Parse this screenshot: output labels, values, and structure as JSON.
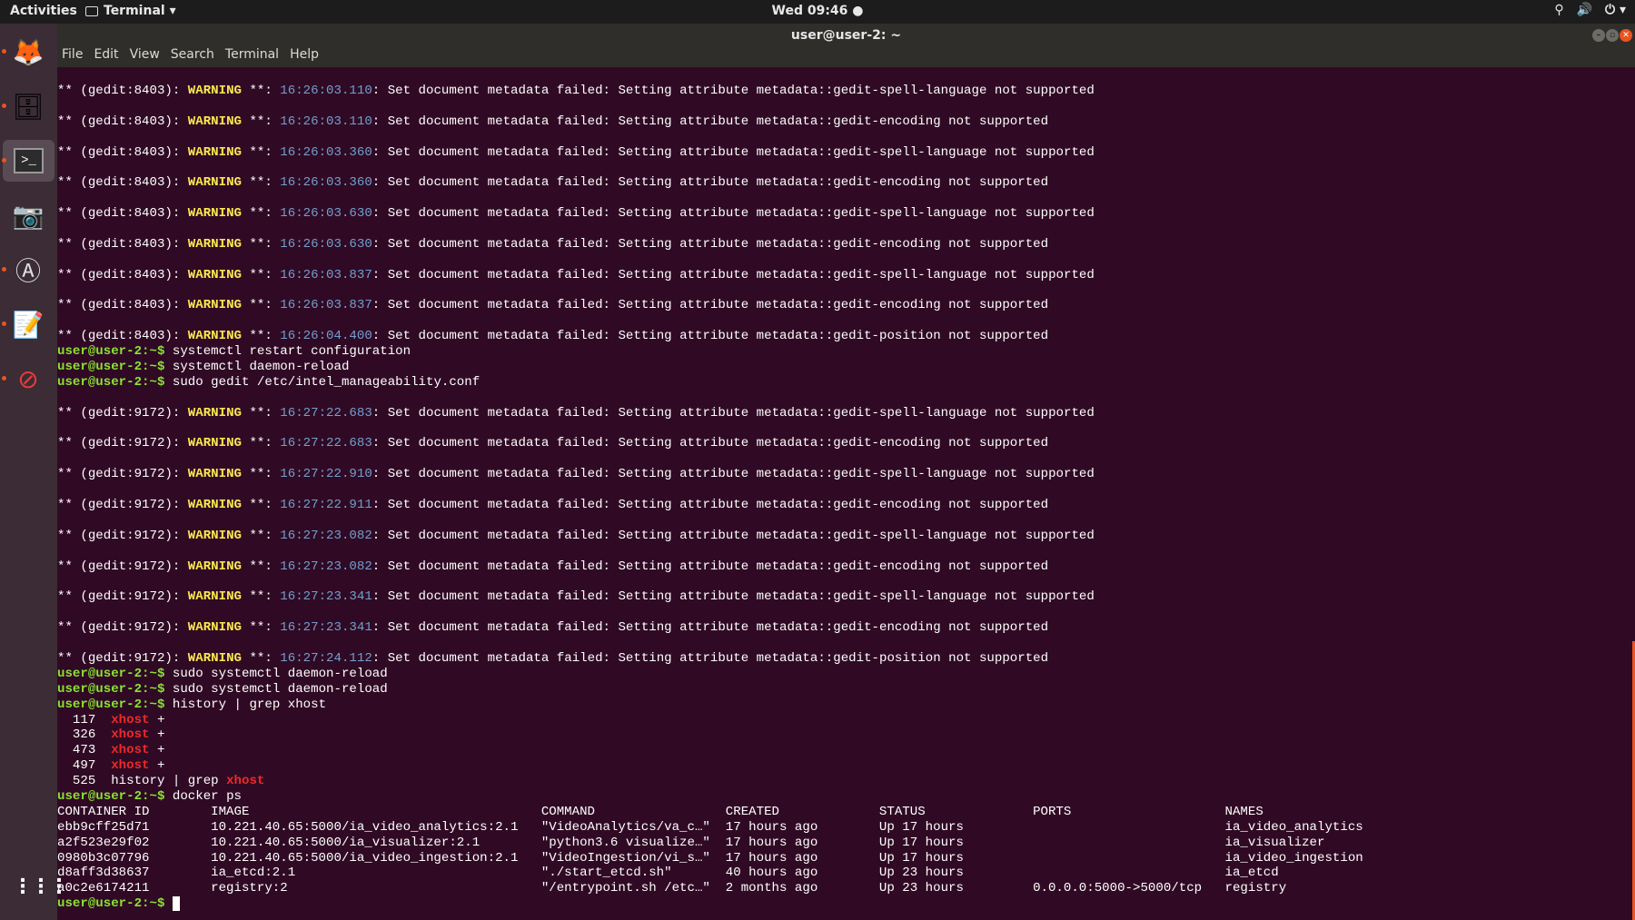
{
  "topbar": {
    "activities": "Activities",
    "app_name": "Terminal ▾",
    "clock": "Wed 09:46 ●",
    "tray": [
      "⚲",
      "🔊",
      "⏻ ▾"
    ]
  },
  "window": {
    "title": "user@user-2: ~",
    "controls": [
      "–",
      "▫",
      "✕"
    ]
  },
  "menu": [
    "File",
    "Edit",
    "View",
    "Search",
    "Terminal",
    "Help"
  ],
  "dock": [
    {
      "name": "firefox",
      "icon": "🦊"
    },
    {
      "name": "files",
      "icon": "🗄"
    },
    {
      "name": "terminal",
      "icon": ">_"
    },
    {
      "name": "camera",
      "icon": "📷"
    },
    {
      "name": "software-updater",
      "icon": "Ⓐ"
    },
    {
      "name": "text-editor",
      "icon": "📝"
    },
    {
      "name": "blocked-app",
      "icon": "⊘"
    }
  ],
  "apps_grid": "⋮⋮⋮",
  "prompt": "user@user-2:~$",
  "lines": [
    {
      "t": "warn",
      "pre": "** (gedit:8403): ",
      "lvl": "WARNING",
      "mid": " **: ",
      "time": "16:26:03.110",
      "msg": ": Set document metadata failed: Setting attribute metadata::gedit-spell-language not supported"
    },
    {
      "t": "blank"
    },
    {
      "t": "warn",
      "pre": "** (gedit:8403): ",
      "lvl": "WARNING",
      "mid": " **: ",
      "time": "16:26:03.110",
      "msg": ": Set document metadata failed: Setting attribute metadata::gedit-encoding not supported"
    },
    {
      "t": "blank"
    },
    {
      "t": "warn",
      "pre": "** (gedit:8403): ",
      "lvl": "WARNING",
      "mid": " **: ",
      "time": "16:26:03.360",
      "msg": ": Set document metadata failed: Setting attribute metadata::gedit-spell-language not supported"
    },
    {
      "t": "blank"
    },
    {
      "t": "warn",
      "pre": "** (gedit:8403): ",
      "lvl": "WARNING",
      "mid": " **: ",
      "time": "16:26:03.360",
      "msg": ": Set document metadata failed: Setting attribute metadata::gedit-encoding not supported"
    },
    {
      "t": "blank"
    },
    {
      "t": "warn",
      "pre": "** (gedit:8403): ",
      "lvl": "WARNING",
      "mid": " **: ",
      "time": "16:26:03.630",
      "msg": ": Set document metadata failed: Setting attribute metadata::gedit-spell-language not supported"
    },
    {
      "t": "blank"
    },
    {
      "t": "warn",
      "pre": "** (gedit:8403): ",
      "lvl": "WARNING",
      "mid": " **: ",
      "time": "16:26:03.630",
      "msg": ": Set document metadata failed: Setting attribute metadata::gedit-encoding not supported"
    },
    {
      "t": "blank"
    },
    {
      "t": "warn",
      "pre": "** (gedit:8403): ",
      "lvl": "WARNING",
      "mid": " **: ",
      "time": "16:26:03.837",
      "msg": ": Set document metadata failed: Setting attribute metadata::gedit-spell-language not supported"
    },
    {
      "t": "blank"
    },
    {
      "t": "warn",
      "pre": "** (gedit:8403): ",
      "lvl": "WARNING",
      "mid": " **: ",
      "time": "16:26:03.837",
      "msg": ": Set document metadata failed: Setting attribute metadata::gedit-encoding not supported"
    },
    {
      "t": "blank"
    },
    {
      "t": "warn",
      "pre": "** (gedit:8403): ",
      "lvl": "WARNING",
      "mid": " **: ",
      "time": "16:26:04.400",
      "msg": ": Set document metadata failed: Setting attribute metadata::gedit-position not supported"
    },
    {
      "t": "cmd",
      "cmd": " systemctl restart configuration"
    },
    {
      "t": "cmd",
      "cmd": " systemctl daemon-reload"
    },
    {
      "t": "cmd",
      "cmd": " sudo gedit /etc/intel_manageability.conf"
    },
    {
      "t": "blank"
    },
    {
      "t": "warn",
      "pre": "** (gedit:9172): ",
      "lvl": "WARNING",
      "mid": " **: ",
      "time": "16:27:22.683",
      "msg": ": Set document metadata failed: Setting attribute metadata::gedit-spell-language not supported"
    },
    {
      "t": "blank"
    },
    {
      "t": "warn",
      "pre": "** (gedit:9172): ",
      "lvl": "WARNING",
      "mid": " **: ",
      "time": "16:27:22.683",
      "msg": ": Set document metadata failed: Setting attribute metadata::gedit-encoding not supported"
    },
    {
      "t": "blank"
    },
    {
      "t": "warn",
      "pre": "** (gedit:9172): ",
      "lvl": "WARNING",
      "mid": " **: ",
      "time": "16:27:22.910",
      "msg": ": Set document metadata failed: Setting attribute metadata::gedit-spell-language not supported"
    },
    {
      "t": "blank"
    },
    {
      "t": "warn",
      "pre": "** (gedit:9172): ",
      "lvl": "WARNING",
      "mid": " **: ",
      "time": "16:27:22.911",
      "msg": ": Set document metadata failed: Setting attribute metadata::gedit-encoding not supported"
    },
    {
      "t": "blank"
    },
    {
      "t": "warn",
      "pre": "** (gedit:9172): ",
      "lvl": "WARNING",
      "mid": " **: ",
      "time": "16:27:23.082",
      "msg": ": Set document metadata failed: Setting attribute metadata::gedit-spell-language not supported"
    },
    {
      "t": "blank"
    },
    {
      "t": "warn",
      "pre": "** (gedit:9172): ",
      "lvl": "WARNING",
      "mid": " **: ",
      "time": "16:27:23.082",
      "msg": ": Set document metadata failed: Setting attribute metadata::gedit-encoding not supported"
    },
    {
      "t": "blank"
    },
    {
      "t": "warn",
      "pre": "** (gedit:9172): ",
      "lvl": "WARNING",
      "mid": " **: ",
      "time": "16:27:23.341",
      "msg": ": Set document metadata failed: Setting attribute metadata::gedit-spell-language not supported"
    },
    {
      "t": "blank"
    },
    {
      "t": "warn",
      "pre": "** (gedit:9172): ",
      "lvl": "WARNING",
      "mid": " **: ",
      "time": "16:27:23.341",
      "msg": ": Set document metadata failed: Setting attribute metadata::gedit-encoding not supported"
    },
    {
      "t": "blank"
    },
    {
      "t": "warn",
      "pre": "** (gedit:9172): ",
      "lvl": "WARNING",
      "mid": " **: ",
      "time": "16:27:24.112",
      "msg": ": Set document metadata failed: Setting attribute metadata::gedit-position not supported"
    },
    {
      "t": "cmd",
      "cmd": " sudo systemctl daemon-reload"
    },
    {
      "t": "cmd",
      "cmd": " sudo systemctl daemon-reload"
    },
    {
      "t": "cmd",
      "cmd": " history | grep xhost"
    },
    {
      "t": "hist",
      "pre": "  117  ",
      "hl": "xhost",
      "post": " +"
    },
    {
      "t": "hist",
      "pre": "  326  ",
      "hl": "xhost",
      "post": " +"
    },
    {
      "t": "hist",
      "pre": "  473  ",
      "hl": "xhost",
      "post": " +"
    },
    {
      "t": "hist",
      "pre": "  497  ",
      "hl": "xhost",
      "post": " +"
    },
    {
      "t": "hist",
      "pre": "  525  history | grep ",
      "hl": "xhost",
      "post": ""
    },
    {
      "t": "cmd",
      "cmd": " docker ps"
    }
  ],
  "docker": {
    "headers": [
      "CONTAINER ID",
      "IMAGE",
      "COMMAND",
      "CREATED",
      "STATUS",
      "PORTS",
      "NAMES"
    ],
    "rows": [
      [
        "ebb9cff25d71",
        "10.221.40.65:5000/ia_video_analytics:2.1",
        "\"VideoAnalytics/va_c…\"",
        "17 hours ago",
        "Up 17 hours",
        "",
        "ia_video_analytics"
      ],
      [
        "a2f523e29f02",
        "10.221.40.65:5000/ia_visualizer:2.1",
        "\"python3.6 visualize…\"",
        "17 hours ago",
        "Up 17 hours",
        "",
        "ia_visualizer"
      ],
      [
        "0980b3c07796",
        "10.221.40.65:5000/ia_video_ingestion:2.1",
        "\"VideoIngestion/vi_s…\"",
        "17 hours ago",
        "Up 17 hours",
        "",
        "ia_video_ingestion"
      ],
      [
        "d8aff3d38637",
        "ia_etcd:2.1",
        "\"./start_etcd.sh\"",
        "40 hours ago",
        "Up 23 hours",
        "",
        "ia_etcd"
      ],
      [
        "a0c2e6174211",
        "registry:2",
        "\"/entrypoint.sh /etc…\"",
        "2 months ago",
        "Up 23 hours",
        "0.0.0.0:5000->5000/tcp",
        "registry"
      ]
    ]
  }
}
